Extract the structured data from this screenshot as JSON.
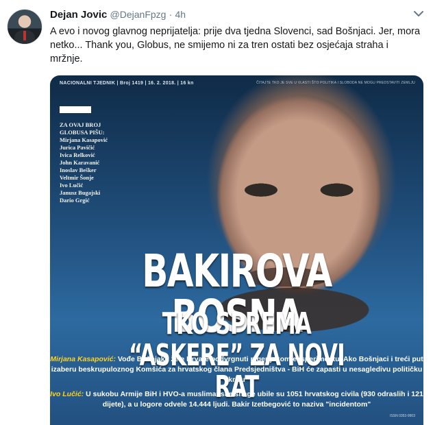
{
  "tweet": {
    "name": "Dejan Jovic",
    "handle": "@DejanFpzg",
    "separator": "·",
    "time": "4h",
    "text": "A evo i novog glavnog neprijatelja: prije dva tjedna Slovenci, sad Bošnjaci. Jer, mora netko... Thank you, Globus, ne smijemo ni za tren ostati bez osjećaja straha i mržnje."
  },
  "icons": {
    "more": "chevron-down-icon"
  },
  "cover": {
    "topbar": "NACIONALNI TJEDNIK | Broj 1419 | 16. 2. 2018. | 16 kn",
    "topbar_right": "ČITAJTE TKO JE SVE U VLASTI ŠTO POLITIKA I SLOBODA NE MOGU PREDSTAVITI ZEMLJU",
    "authors_title": "ZA OVAJ BROJ GLOBUSA PIŠU:",
    "authors": [
      "Mirjana Kasapović",
      "Jurica Pavičić",
      "Ivica Relković",
      "John Karavanić",
      "Inoslav Bešker",
      "Veltmir Šonje",
      "Ivo Lučić",
      "Janusz Bugajski",
      "Dario Grgić"
    ],
    "headline": "BAKIROVA BOSNA",
    "subhead": "TKO SPREMA “ASKERE” ZA NOVI RAT",
    "teaser1_name": "Mirjana Kasapović:",
    "teaser1_text": "Vođe Bošnjaka žele Hrvate podvrgnuti nigerijskom eksperimentu. Ako Bošnjaci i treći put izaberu beskrupuloznog Komšića za hrvatskog člana Predsjedništva - BiH će zapasti u nesagledivu političku krizu",
    "teaser2_name": "Ivo Lučić:",
    "teaser2_text": "U sukobu Armije BiH i HVO-a muslimanske snage ubile su 1051 hrvatskog civila (930 odraslih i 121 dijete), a u logore odvele 14.444 ljudi. Bakir Izetbegović to naziva \"incidentom\"",
    "isbn": "ISSN 0353-9903"
  }
}
